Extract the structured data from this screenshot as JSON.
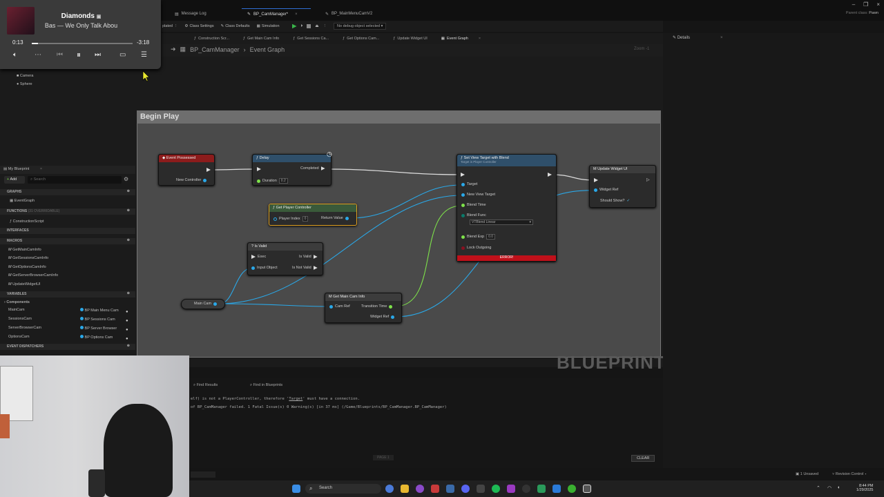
{
  "window": {
    "parent_class_label": "Parent class:",
    "parent_class_value": "Pawn"
  },
  "tabs": [
    {
      "label": "Message Log"
    },
    {
      "label": "BP_CamManager*"
    },
    {
      "label": "BP_MainMenuCamV2"
    }
  ],
  "toolbar": {
    "compile_partial": "plated",
    "construction_settings": "Class Settings",
    "class_defaults": "Class Defaults",
    "simulation": "Simulation",
    "debug_select": "No debug object selected"
  },
  "graph_tabs": [
    "Construction Scr...",
    "Get Main Cam Info",
    "Get Sessions Ca...",
    "Get Options Cam...",
    "Update Widget UI",
    "Event Graph"
  ],
  "breadcrumb": {
    "blueprint": "BP_CamManager",
    "graph": "Event Graph"
  },
  "zoom_label": "Zoom -1",
  "comment": {
    "title": "Begin Play"
  },
  "watermark": "BLUEPRINT",
  "nodes": {
    "event_possessed": {
      "title": "Event Possessed",
      "pin": "New Controller"
    },
    "delay": {
      "title": "Delay",
      "completed": "Completed",
      "duration": "Duration",
      "duration_val": "0.2"
    },
    "get_player_controller": {
      "title": "Get Player Controller",
      "player_index": "Player Index",
      "player_index_val": "0",
      "return_value": "Return Value"
    },
    "is_valid": {
      "title": "Is Valid",
      "exec": "Exec",
      "input_object": "Input Object",
      "is_valid": "Is Valid",
      "is_not_valid": "Is Not Valid"
    },
    "main_cam_var": {
      "label": "Main Cam"
    },
    "get_main_cam_info": {
      "title": "Get Main Cam Info",
      "cam_ref": "Cam Ref",
      "transition_time": "Transition Time",
      "widget_ref": "Widget Ref"
    },
    "set_view_target": {
      "title": "Set View Target with Blend",
      "subtitle": "Target is Player Controller",
      "target": "Target",
      "new_view_target": "New View Target",
      "blend_time": "Blend Time",
      "blend_func": "Blend Func",
      "blend_func_val": "VTBlend Linear",
      "blend_exp": "Blend Exp",
      "blend_exp_val": "0.0",
      "lock_outgoing": "Lock Outgoing",
      "error": "ERROR!"
    },
    "update_widget_ui": {
      "title": "Update Widget UI",
      "widget_ref": "Widget Ref",
      "should_show": "Should Show?"
    }
  },
  "left_panel": {
    "components": [
      "Camera",
      "Sphere"
    ],
    "my_blueprint": "My Blueprint",
    "add": "Add",
    "search_placeholder": "Search",
    "graphs_label": "GRAPHS",
    "event_graph": "EventGraph",
    "functions_label": "FUNCTIONS",
    "functions_overridable": "(31 OVERRIDABLE)",
    "construction_script": "ConstructionScript",
    "interfaces_label": "INTERFACES",
    "macros_label": "MACROS",
    "macros": [
      "GetMainCamInfo",
      "GetSessionsCamInfo",
      "GetOptionsCamInfo",
      "GetServerBrowserCamInfo",
      "UpdateWidgetUI"
    ],
    "variables_label": "VARIABLES",
    "components_label": "Components",
    "variables": [
      {
        "name": "MainCam",
        "type": "BP Main Menu Cam"
      },
      {
        "name": "SessionsCam",
        "type": "BP Sessions Cam"
      },
      {
        "name": "ServerBrowserCam",
        "type": "BP Server Browser"
      },
      {
        "name": "OptionsCam",
        "type": "BP Options Cam"
      }
    ],
    "event_dispatchers_label": "EVENT DISPATCHERS"
  },
  "media": {
    "title": "Diamonds",
    "artist": "Bas — We Only Talk Abou",
    "time_current": "0:13",
    "time_remaining": "-3:18",
    "progress": 0.06
  },
  "details": {
    "title": "Details"
  },
  "log": {
    "tab_find_results": "Find Results",
    "tab_find_in_blueprints": "Find in Blueprints",
    "line1_a": "elf) is not a PlayerController, therefore '",
    "line1_b": "Target",
    "line1_c": "' must have a connection.",
    "line2": "of BP_CamManager failed. 1 Fatal Issue(s) 0 Warning(s) [in 37 ms] (/Game/Blueprints/BP_CamManager.BP_CamManager)",
    "page": "PAGE 1",
    "clear": "CLEAR"
  },
  "statusbar": {
    "unsaved": "1 Unsaved",
    "revision": "Revision Control"
  },
  "taskbar": {
    "search": "Search",
    "time": "8:44 PM",
    "date": "1/29/2025"
  },
  "colors": {
    "exec": "#dddddd",
    "object": "#2aa8e8",
    "float": "#7ee24a",
    "error": "#c0101a",
    "event_head": "#8c1c1c",
    "func_head": "#2f4f6a"
  }
}
